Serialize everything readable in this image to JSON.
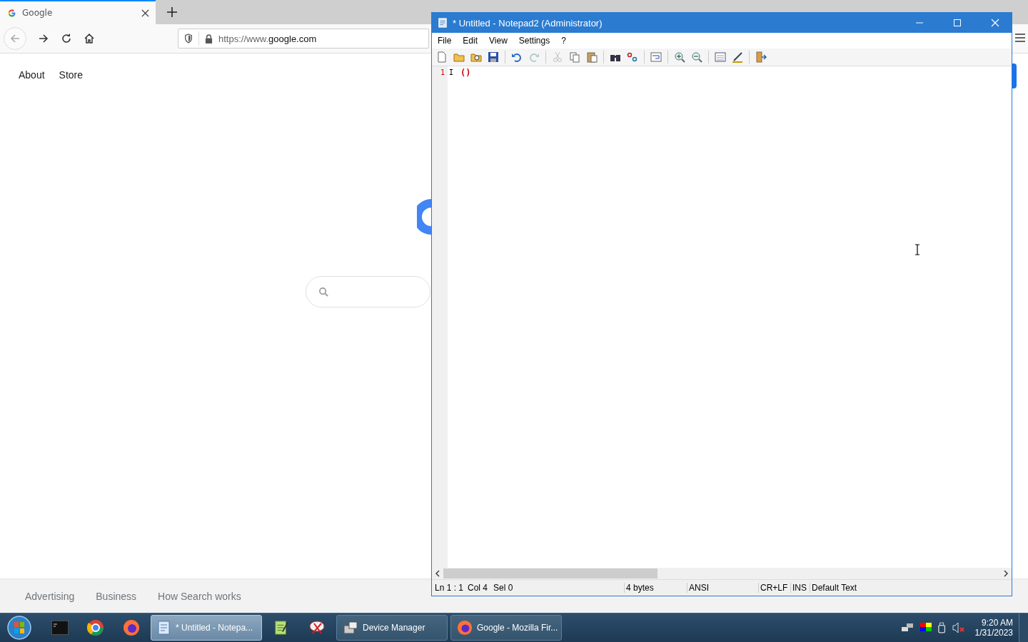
{
  "browser": {
    "tab": {
      "title": "Google",
      "selected": true
    },
    "url": {
      "scheme": "https://www.",
      "domain": "google.com"
    },
    "top_links": [
      "About",
      "Store"
    ],
    "footer_links": [
      "Advertising",
      "Business",
      "How Search works"
    ]
  },
  "notepad": {
    "title": "* Untitled - Notepad2 (Administrator)",
    "menu": [
      "File",
      "Edit",
      "View",
      "Settings",
      "?"
    ],
    "lines": [
      {
        "number": "1",
        "text": "I",
        "brace": "()"
      }
    ],
    "status": [
      "Ln 1 : 1",
      "Col 4",
      "Sel 0",
      "4 bytes",
      "ANSI",
      "CR+LF",
      "INS",
      "Default Text"
    ]
  },
  "taskbar": {
    "items": [
      {
        "kind": "pinned",
        "selected": false
      },
      {
        "kind": "pinned",
        "selected": false
      },
      {
        "kind": "pinned",
        "selected": false
      },
      {
        "kind": "window",
        "label": "* Untitled - Notepa...",
        "selected": true
      },
      {
        "kind": "pinned",
        "selected": false
      },
      {
        "kind": "pinned",
        "selected": false
      },
      {
        "kind": "window",
        "label": "Device Manager",
        "selected": false
      },
      {
        "kind": "window",
        "label": "Google - Mozilla Fir...",
        "selected": false
      }
    ],
    "clock": {
      "time": "9:20 AM",
      "date": "1/31/2023"
    }
  }
}
